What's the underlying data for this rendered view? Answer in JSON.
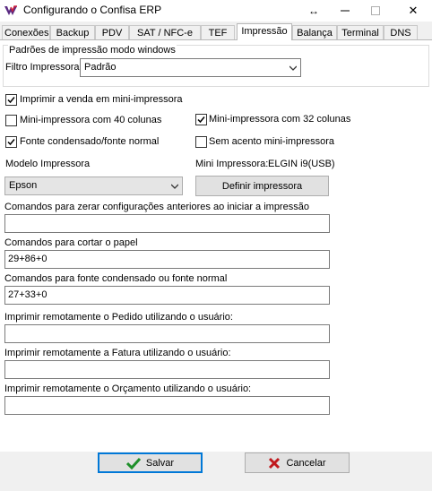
{
  "window": {
    "title": "Configurando o Confisa ERP",
    "minimize": "",
    "maximize": "",
    "close": "✕",
    "resize": "↔"
  },
  "tabs": [
    {
      "label": "Conexões"
    },
    {
      "label": "Backup"
    },
    {
      "label": "PDV"
    },
    {
      "label": "SAT / NFC-e"
    },
    {
      "label": "TEF"
    },
    {
      "label": "Impressão"
    },
    {
      "label": "Balança"
    },
    {
      "label": "Terminal"
    },
    {
      "label": "DNS"
    }
  ],
  "windows_print": {
    "group_title": "Padrões de impressão modo windows",
    "filter_label": "Filtro Impressora:",
    "filter_value": "Padrão"
  },
  "options": {
    "print_on_mini": {
      "label": "Imprimir a venda em mini-impressora",
      "checked": true
    },
    "mini_40": {
      "label": "Mini-impressora com 40 colunas",
      "checked": false
    },
    "mini_32": {
      "label": "Mini-impressora com 32 colunas",
      "checked": true
    },
    "condensed_font": {
      "label": "Fonte condensado/fonte normal",
      "checked": true
    },
    "no_accent": {
      "label": "Sem acento mini-impressora",
      "checked": false
    }
  },
  "model": {
    "label": "Modelo Impressora",
    "value": "Epson"
  },
  "mini_printer": {
    "label": "Mini Impressora:",
    "value": "ELGIN i9(USB)",
    "button": "Definir impressora"
  },
  "fields": {
    "reset_commands": {
      "label": "Comandos para zerar configurações anteriores ao iniciar a impressão",
      "value": ""
    },
    "cut_commands": {
      "label": "Comandos para cortar o papel",
      "value": "29+86+0"
    },
    "font_commands": {
      "label": "Comandos para fonte condensado ou fonte normal",
      "value": "27+33+0"
    },
    "remote_order": {
      "label": "Imprimir remotamente o Pedido utilizando o usuário:",
      "value": ""
    },
    "remote_invoice": {
      "label": "Imprimir remotamente a Fatura utilizando o usuário:",
      "value": ""
    },
    "remote_quote": {
      "label": "Imprimir remotamente o Orçamento utilizando o usuário:",
      "value": ""
    }
  },
  "footer": {
    "save": "Salvar",
    "cancel": "Cancelar"
  },
  "colors": {
    "accent": "#0078d7",
    "save_check": "#1e8f2a",
    "cancel_x": "#c0181d"
  }
}
